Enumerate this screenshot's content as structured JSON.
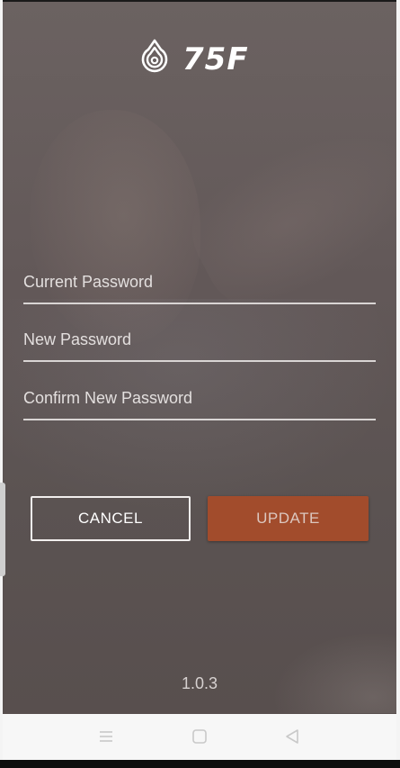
{
  "app": {
    "logo_text": "75F",
    "icon": "75f-drop-logo-icon"
  },
  "form": {
    "current_password": {
      "placeholder": "Current Password",
      "value": ""
    },
    "new_password": {
      "placeholder": "New Password",
      "value": ""
    },
    "confirm_password": {
      "placeholder": "Confirm New Password",
      "value": ""
    }
  },
  "actions": {
    "cancel_label": "CANCEL",
    "update_label": "UPDATE"
  },
  "footer": {
    "version": "1.0.3"
  },
  "nav": {
    "recent_icon": "menu-lines-icon",
    "home_icon": "square-home-icon",
    "back_icon": "triangle-back-icon"
  },
  "colors": {
    "overlay": "#625858",
    "field_underline": "#d9d5d4",
    "update_button": "#a24c2c",
    "update_text": "#dcc7bf",
    "nav_bar": "#f7f7f7"
  }
}
